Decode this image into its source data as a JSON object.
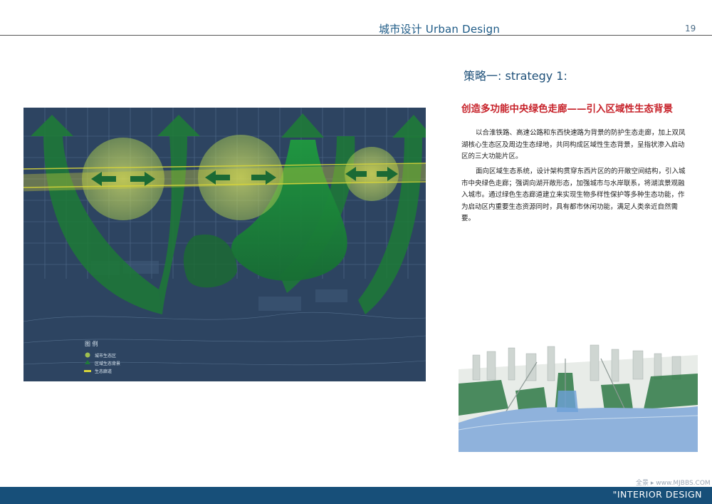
{
  "header": {
    "title": "城市设计 Urban Design",
    "page_number": "19"
  },
  "strategy": {
    "heading": "策略一:  strategy 1:",
    "subtitle": "创造多功能中央绿色走廊——引入区域性生态背景"
  },
  "paragraphs": [
    "以合淮铁路、高速公路和东西快速路为背景的防护生态走廊，加上双凤湖核心生态区及周边生态绿地，共同构成区域性生态背景，呈指状渗入启动区的三大功能片区。",
    "面向区域生态系统，设计架构贯穿东西片区的的开敞空间结构，引入城市中央绿色走廊；强调向湖开敞形态，加强城市与水岸联系，将湖滨景观融入城市。通过绿色生态廊道建立来实现生物多样性保护等多种生态功能，作为启动区内重要生态资源同时，具有都市休闲功能，满足人类亲近自然需要。"
  ],
  "legend": {
    "title": "图  例",
    "items": [
      {
        "label": "城市生态区"
      },
      {
        "label": "区域生态背景"
      },
      {
        "label": "生态廊道"
      }
    ]
  },
  "colors": {
    "accent_blue": "#174f79",
    "subtitle_red": "#c7222a",
    "map_bg": "#2f4663",
    "green": "#1f8a3a",
    "corridor_yellow": "#d6d43a"
  },
  "footer": {
    "label": "\"INTERIOR DESIGN",
    "watermark": "全景 ▸ www.MJBBS.COM"
  }
}
